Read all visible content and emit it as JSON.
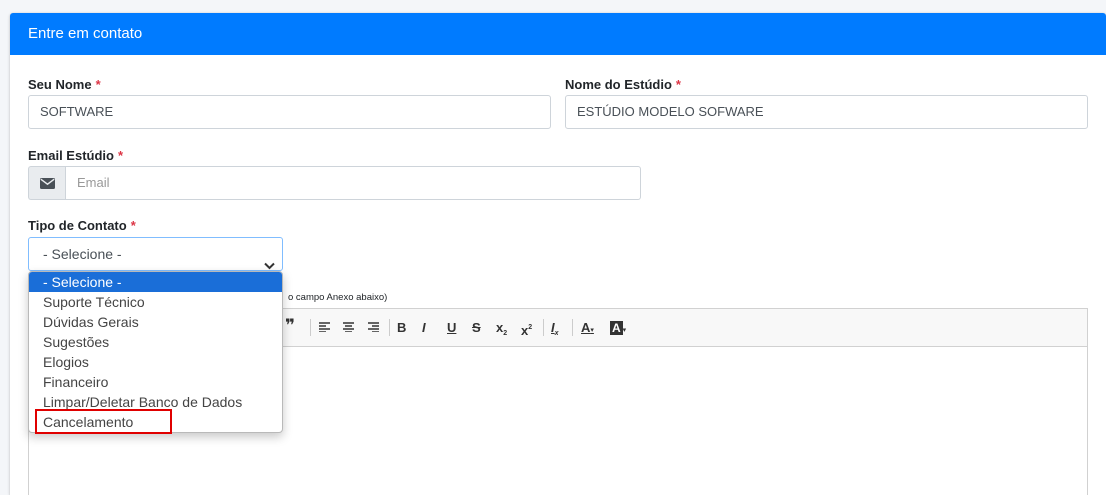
{
  "card": {
    "title": "Entre em contato"
  },
  "form": {
    "nome_label": "Seu Nome",
    "nome_value": "SOFTWARE",
    "estudio_label": "Nome do Estúdio",
    "estudio_value": "ESTÚDIO MODELO SOFWARE",
    "email_label": "Email Estúdio",
    "email_placeholder": "Email",
    "tipo_label": "Tipo de Contato",
    "tipo_value": "- Selecione -",
    "required_mark": "*",
    "hint_text": "o campo Anexo abaixo)"
  },
  "dropdown": {
    "options": [
      "- Selecione -",
      "Suporte Técnico",
      "Dúvidas Gerais",
      "Sugestões",
      "Elogios",
      "Financeiro",
      "Limpar/Deletar Banco de Dados",
      "Cancelamento"
    ],
    "selected_index": 0,
    "highlighted_option": "Cancelamento"
  },
  "toolbar": {
    "quote": "❞",
    "bold": "B",
    "italic": "I",
    "underline": "U",
    "strike": "S",
    "subscript": "x",
    "superscript": "x",
    "clear_format": "I",
    "text_color": "A",
    "bg_color": "A"
  },
  "colors": {
    "header": "#007bff",
    "required": "#dc3545",
    "selected_option": "#1a6ed8",
    "highlight_border": "#e00000"
  }
}
